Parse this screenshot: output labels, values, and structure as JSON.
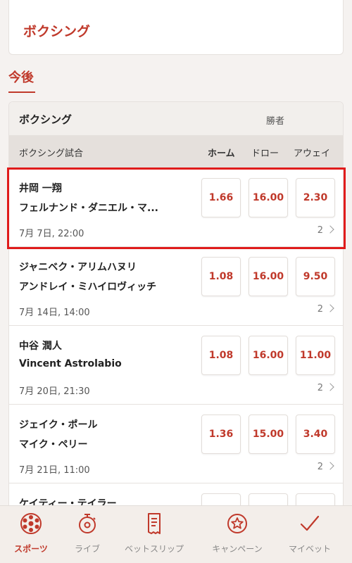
{
  "header": {
    "title": "ボクシング"
  },
  "tabs": {
    "active_label": "今後"
  },
  "table": {
    "sport_label": "ボクシング",
    "market_label": "勝者",
    "col_match": "ボクシング試合",
    "col_home": "ホーム",
    "col_draw": "ドロー",
    "col_away": "アウェイ"
  },
  "events": [
    {
      "team1": "井岡 一翔",
      "team2": "フェルナンド・ダニエル・マ...",
      "time": "7月 7日, 22:00",
      "odds": [
        "1.66",
        "16.00",
        "2.30"
      ],
      "more": "2",
      "highlighted": true
    },
    {
      "team1": "ジャニベク・アリムハヌリ",
      "team2": "アンドレイ・ミハイロヴィッチ",
      "time": "7月 14日, 14:00",
      "odds": [
        "1.08",
        "16.00",
        "9.50"
      ],
      "more": "2"
    },
    {
      "team1": "中谷 潤人",
      "team2": "Vincent Astrolabio",
      "time": "7月 20日, 21:30",
      "odds": [
        "1.08",
        "16.00",
        "11.00"
      ],
      "more": "2"
    },
    {
      "team1": "ジェイク・ポール",
      "team2": "マイク・ペリー",
      "time": "7月 21日, 11:00",
      "odds": [
        "1.36",
        "15.00",
        "3.40"
      ],
      "more": "2"
    },
    {
      "team1": "ケイティー・テイラー",
      "team2": "",
      "time": "",
      "odds": [
        "",
        "",
        ""
      ],
      "more": ""
    }
  ],
  "nav": [
    {
      "label": "スポーツ",
      "icon": "sports-ball-icon",
      "active": true
    },
    {
      "label": "ライブ",
      "icon": "stopwatch-icon"
    },
    {
      "label": "ベットスリップ",
      "icon": "betslip-receipt-icon"
    },
    {
      "label": "キャンペーン",
      "icon": "star-badge-icon"
    },
    {
      "label": "マイベット",
      "icon": "checkmark-icon"
    }
  ],
  "colors": {
    "accent": "#c0392b",
    "highlight_frame": "#e01b1b",
    "nav_bg": "#f3eeea"
  }
}
